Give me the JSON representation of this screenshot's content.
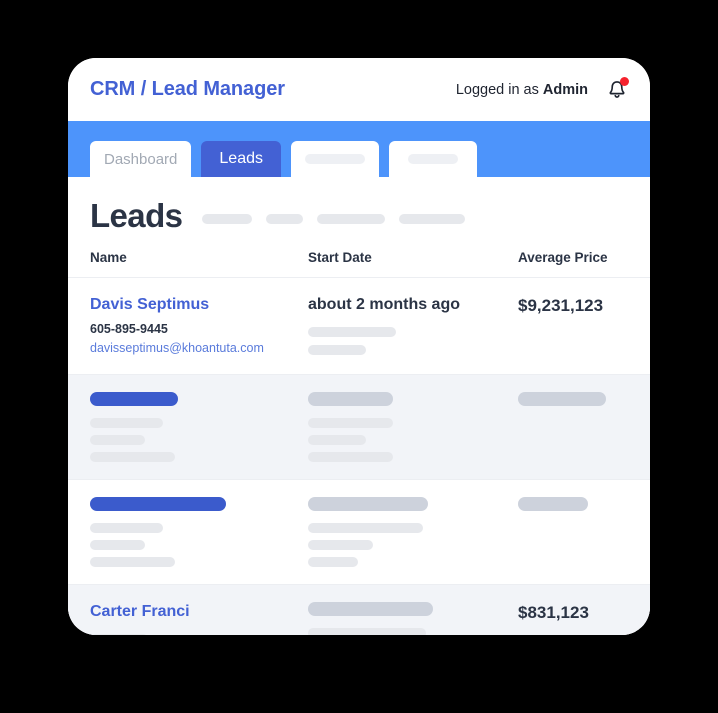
{
  "window": {
    "background": "#000000",
    "card_background": "#ffffff"
  },
  "header": {
    "brand": "CRM / Lead Manager",
    "brand_color": "#4361d4",
    "session_prefix": "Logged in as",
    "session_user": "Admin",
    "notification_icon": "bell-icon",
    "notification_dot_color": "#f5222d",
    "has_unread": true
  },
  "tabs": {
    "bar_color": "#4d94fb",
    "active_tab_color": "#4361d4",
    "items": [
      {
        "label": "Dashboard",
        "active": false,
        "placeholder": false
      },
      {
        "label": "Leads",
        "active": true,
        "placeholder": false
      },
      {
        "label": "",
        "active": false,
        "placeholder": true
      },
      {
        "label": "",
        "active": false,
        "placeholder": true
      }
    ]
  },
  "page": {
    "title": "Leads",
    "title_placeholder_widths": [
      50,
      37,
      68,
      66
    ]
  },
  "table": {
    "columns": [
      "Name",
      "Start Date",
      "Average Price"
    ],
    "rows": [
      {
        "loaded": true,
        "shaded": false,
        "name": "Davis Septimus",
        "phone": "605-895-9445",
        "email": "davisseptimus@khoantuta.com",
        "start_date": "about 2 months ago",
        "average_price": "$9,231,123",
        "date_placeholder_widths": [
          88,
          58
        ],
        "price_placeholder_width": 0
      },
      {
        "loaded": false,
        "shaded": true,
        "name": "",
        "phone": "",
        "email": "",
        "start_date": "",
        "average_price": "",
        "name_bar_width": 88,
        "name_placeholder_widths": [
          73,
          55,
          85
        ],
        "date_placeholder_widths": [
          85,
          58,
          85
        ],
        "price_placeholder_width": 88
      },
      {
        "loaded": false,
        "shaded": false,
        "name": "",
        "phone": "",
        "email": "",
        "start_date": "",
        "average_price": "",
        "name_bar_width": 136,
        "name_placeholder_widths": [
          73,
          55,
          85
        ],
        "date_placeholder_widths": [
          120,
          65,
          50
        ],
        "price_placeholder_width": 70
      },
      {
        "loaded": true,
        "shaded": true,
        "name": "Carter Franci",
        "phone": "",
        "email": "",
        "start_date": "",
        "average_price": "$831,123",
        "name_placeholder_widths": [
          58,
          90
        ],
        "date_placeholder_widths": [
          125,
          118,
          65,
          50
        ],
        "price_placeholder_width": 0
      }
    ]
  }
}
